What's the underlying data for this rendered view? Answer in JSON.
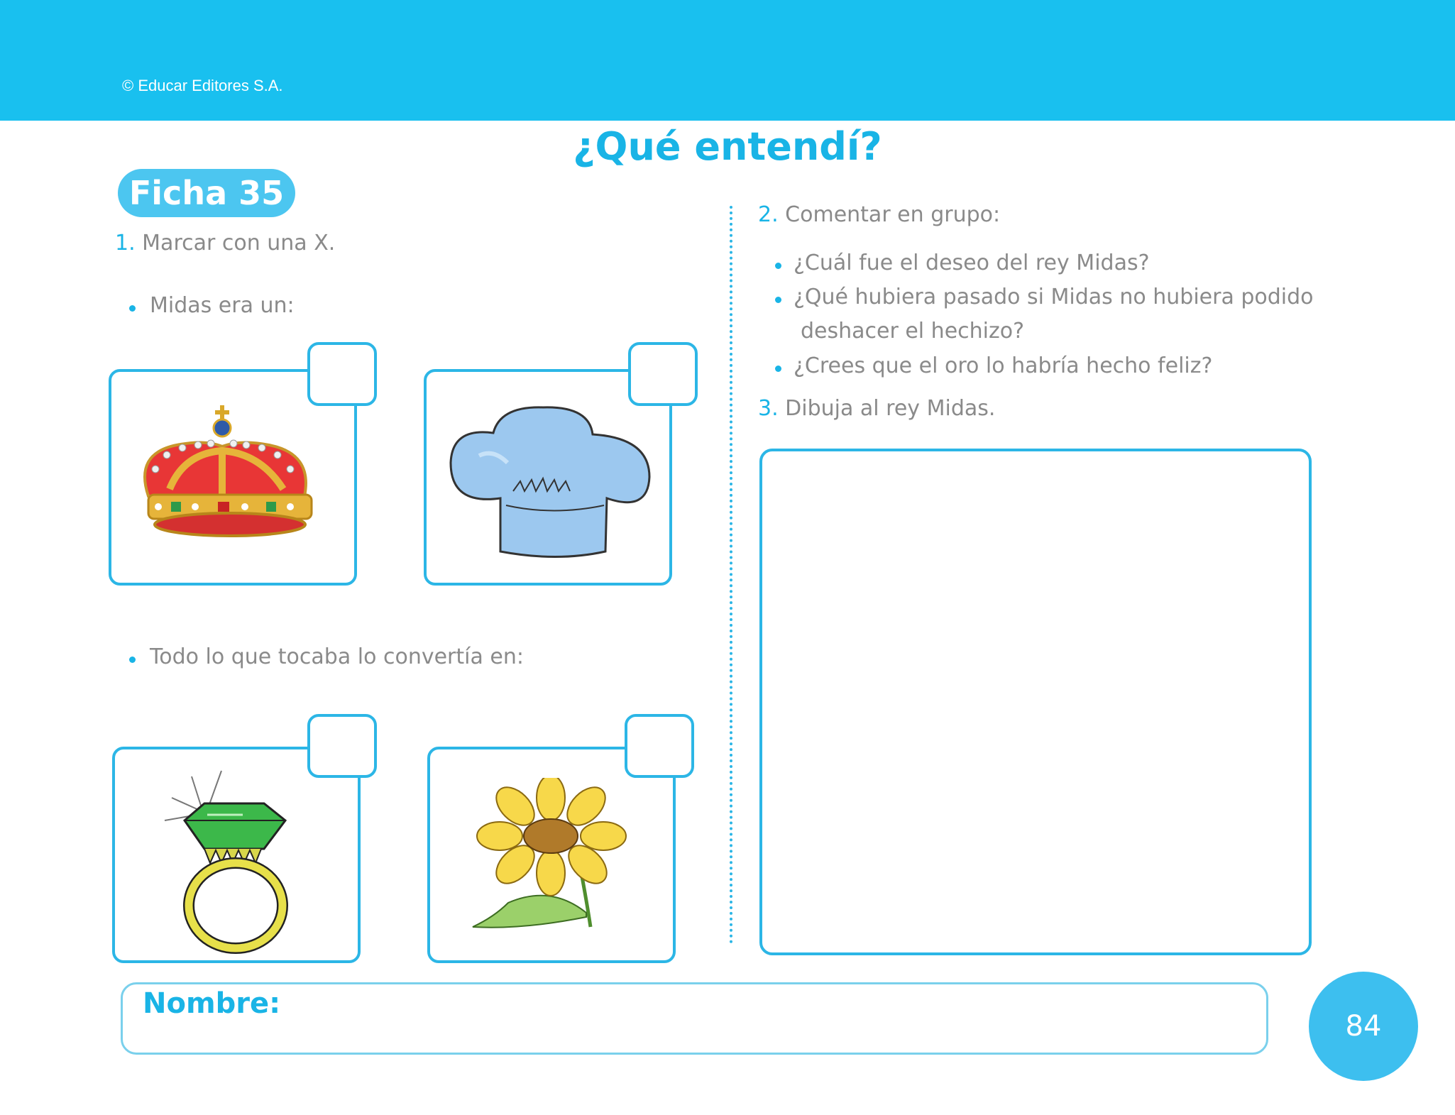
{
  "header": {
    "copyright": "© Educar Editores S.A."
  },
  "title": "¿Qué entendí?",
  "ficha": "Ficha 35",
  "section1": {
    "number": "1.",
    "instruction": "Marcar con una X.",
    "q1": "Midas era un:",
    "q2": "Todo lo que tocaba lo convertía en:"
  },
  "section2": {
    "number": "2.",
    "instruction": "Comentar en grupo:",
    "questions": [
      "¿Cuál fue el deseo del rey Midas?",
      "¿Qué hubiera pasado si Midas no hubiera podido",
      "deshacer el hechizo?",
      "¿Crees que el oro lo habría hecho feliz?"
    ]
  },
  "section3": {
    "number": "3.",
    "instruction": "Dibuja al rey Midas."
  },
  "footer": {
    "name_label": "Nombre:",
    "page_number": "84"
  },
  "colors": {
    "accent": "#19c0ef",
    "border": "#2cb6e6",
    "text": "#8a8a8a"
  }
}
